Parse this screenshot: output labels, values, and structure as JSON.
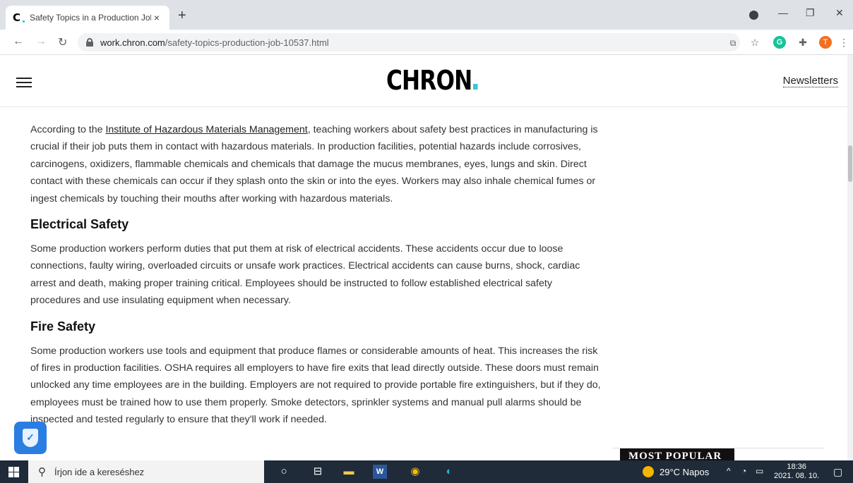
{
  "browser": {
    "tab_title": "Safety Topics in a Production Job",
    "tab_close": "×",
    "new_tab": "+",
    "favicon": "C",
    "url_host": "work.chron.com",
    "url_path": "/safety-topics-production-job-10537.html",
    "avatar_letter": "T",
    "ext_letter": "G"
  },
  "site": {
    "logo": "CHRON",
    "newsletters": "Newsletters",
    "logo_dot_color": "#38c6d9"
  },
  "article": {
    "p1_before_link": "According to the ",
    "p1_link": "Institute of Hazardous Materials Management",
    "p1_after_link": ", teaching workers about safety best practices in manufacturing is crucial if their job puts them in contact with hazardous materials. In production facilities, potential hazards include corrosives, carcinogens, oxidizers, flammable chemicals and chemicals that damage the mucus membranes, eyes, lungs and skin. Direct contact with these chemicals can occur if they splash onto the skin or into the eyes. Workers may also inhale chemical fumes or ingest chemicals by touching their mouths after working with hazardous materials.",
    "h_electrical": "Electrical Safety",
    "p_electrical": "Some production workers perform duties that put them at risk of electrical accidents. These accidents occur due to loose connections, faulty wiring, overloaded circuits or unsafe work practices. Electrical accidents can cause burns, shock, cardiac arrest and death, making proper training critical. Employees should be instructed to follow established electrical safety procedures and use insulating equipment when necessary.",
    "h_fire": "Fire Safety",
    "p_fire": "Some production workers use tools and equipment that produce flames or considerable amounts of heat. This increases the risk of fires in production facilities. OSHA requires all employers to have fire exits that lead directly outside. These doors must remain unlocked any time employees are in the building. Employers are not required to provide portable fire extinguishers, but if they do, employees must be trained how to use them properly. Smoke detectors, sprinkler systems and manual pull alarms should be inspected and tested regularly to ensure that they'll work if needed."
  },
  "sidebar": {
    "most_popular": "MOST POPULAR"
  },
  "taskbar": {
    "search_placeholder": "Írjon ide a kereséshez",
    "weather": "29°C  Napos",
    "time": "18:36",
    "date": "2021. 08. 10."
  }
}
